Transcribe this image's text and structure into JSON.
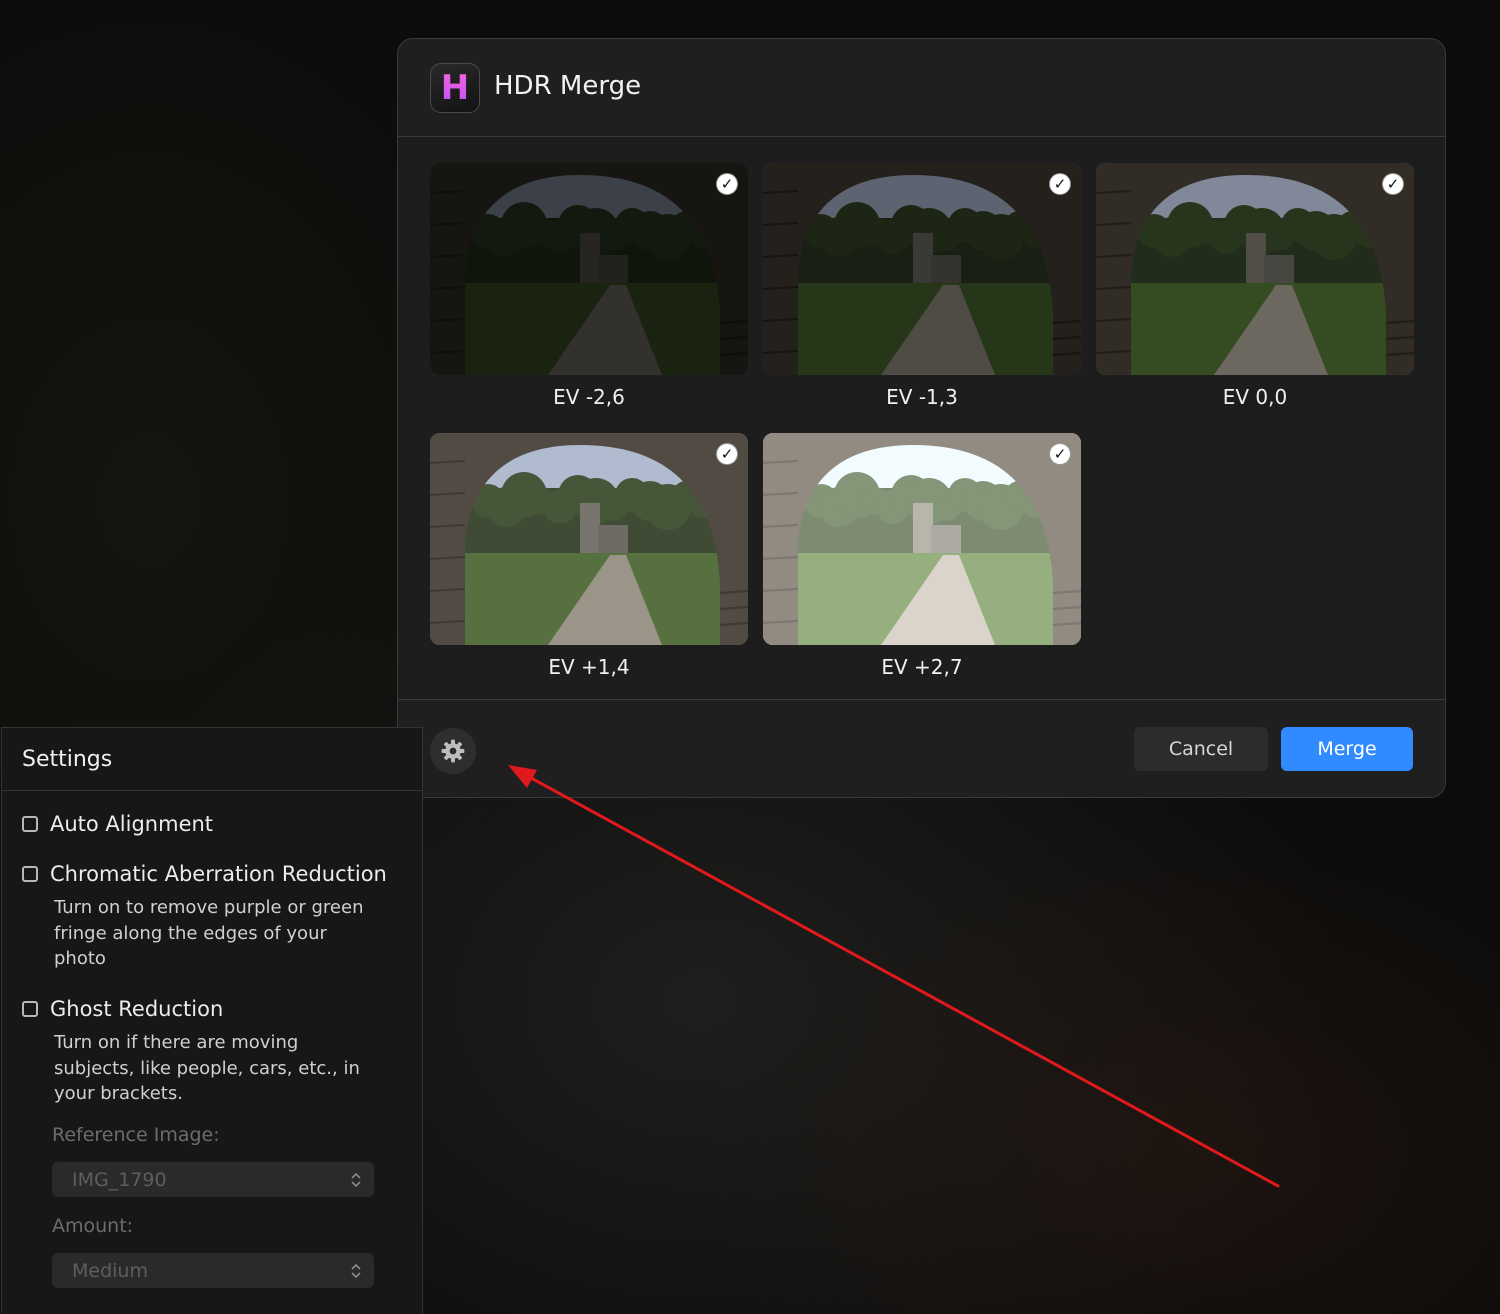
{
  "dialog": {
    "title": "HDR Merge",
    "app_icon": {
      "letter": "H",
      "name": "hdr-app-icon",
      "accent": "#c24bff"
    },
    "images": [
      {
        "label": "EV -2,6",
        "checked": true,
        "exposure": 0.4
      },
      {
        "label": "EV -1,3",
        "checked": true,
        "exposure": 0.62
      },
      {
        "label": "EV 0,0",
        "checked": true,
        "exposure": 0.85
      },
      {
        "label": "EV +1,4",
        "checked": true,
        "exposure": 1.12
      },
      {
        "label": "EV +2,7",
        "checked": true,
        "exposure": 1.38
      }
    ],
    "footer": {
      "settings_icon": "gear-icon",
      "cancel_label": "Cancel",
      "merge_label": "Merge",
      "merge_color": "#2f8bff"
    }
  },
  "settings": {
    "title": "Settings",
    "options": [
      {
        "label": "Auto Alignment",
        "checked": false,
        "description": ""
      },
      {
        "label": "Chromatic Aberration Reduction",
        "checked": false,
        "description": "Turn on to remove purple or green fringe along the edges of your photo"
      },
      {
        "label": "Ghost Reduction",
        "checked": false,
        "description": "Turn on if there are moving subjects, like people, cars, etc., in your brackets."
      }
    ],
    "reference_image": {
      "label": "Reference Image:",
      "value": "IMG_1790",
      "disabled": true
    },
    "amount": {
      "label": "Amount:",
      "value": "Medium",
      "disabled": true
    }
  },
  "annotation": {
    "type": "arrow",
    "color": "#e0191c",
    "target": "settings-gear-button"
  }
}
